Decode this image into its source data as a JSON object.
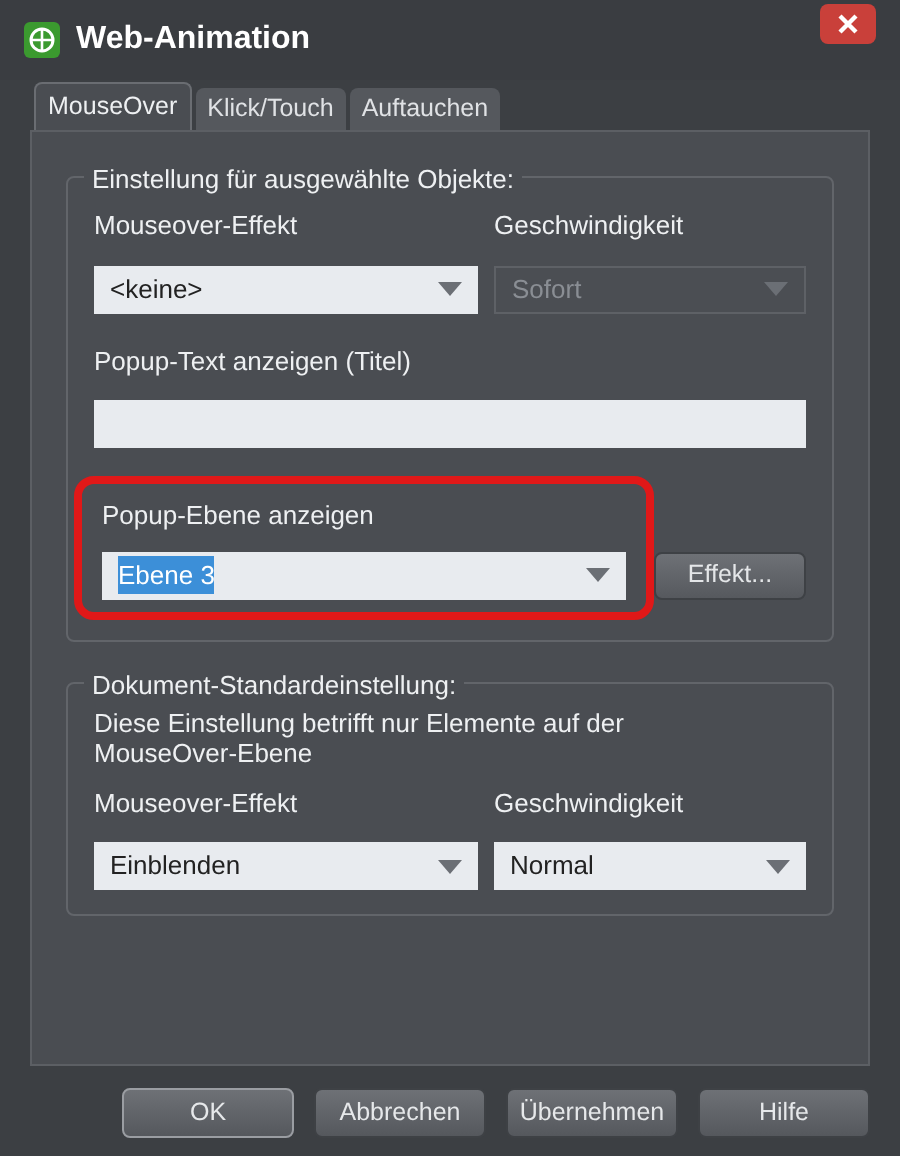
{
  "window": {
    "title": "Web-Animation"
  },
  "tabs": [
    {
      "label": "MouseOver",
      "selected": true
    },
    {
      "label": "Klick/Touch",
      "selected": false
    },
    {
      "label": "Auftauchen",
      "selected": false
    }
  ],
  "selected_objects": {
    "legend": "Einstellung für ausgewählte Objekte:",
    "mouseover_effect": {
      "label": "Mouseover-Effekt",
      "value": "<keine>",
      "disabled": false
    },
    "speed": {
      "label": "Geschwindigkeit",
      "value": "Sofort",
      "disabled": true
    },
    "popup_text": {
      "label": "Popup-Text anzeigen (Titel)"
    },
    "popup_layer": {
      "label": "Popup-Ebene anzeigen",
      "value": "Ebene 3",
      "text_selected": true,
      "highlighted": true
    },
    "effect_button": {
      "label": "Effekt..."
    }
  },
  "document_defaults": {
    "legend": "Dokument-Standardeinstellung:",
    "note": "Diese Einstellung betrifft nur Elemente auf der MouseOver-Ebene",
    "mouseover_effect": {
      "label": "Mouseover-Effekt",
      "value": "Einblenden",
      "disabled": false
    },
    "speed": {
      "label": "Geschwindigkeit",
      "value": "Normal",
      "disabled": false
    }
  },
  "buttons": [
    {
      "label": "OK",
      "default": true
    },
    {
      "label": "Abbrechen",
      "default": false
    },
    {
      "label": "Übernehmen",
      "default": false
    },
    {
      "label": "Hilfe",
      "default": false
    }
  ]
}
